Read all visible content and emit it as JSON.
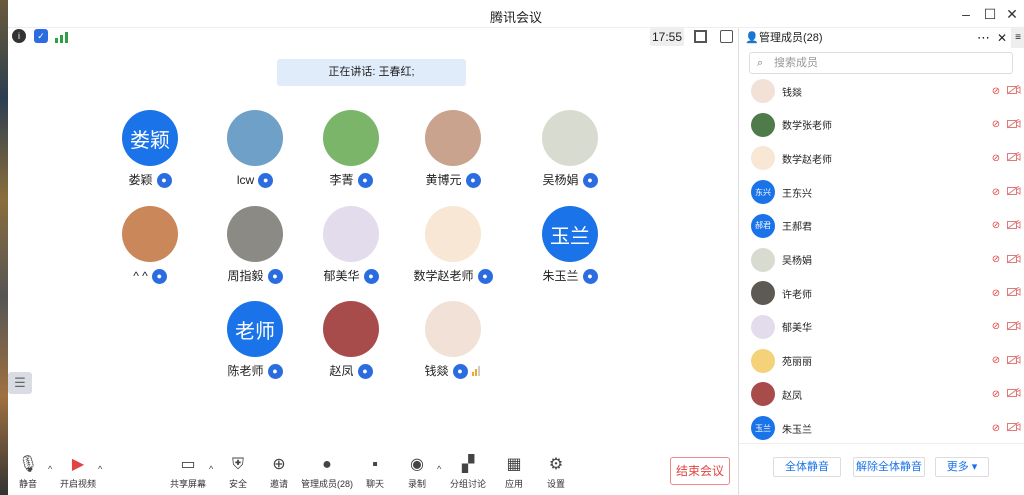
{
  "window": {
    "title": "腾讯会议"
  },
  "topbar": {
    "clock": "17:55"
  },
  "stage": {
    "speaking": "正在讲话: 王春红;",
    "participants": [
      {
        "name": "娄颖",
        "avatar_text": "娄颖",
        "kind": "blue"
      },
      {
        "name": "lcw",
        "avatar_text": "",
        "kind": "photo",
        "color": "#6fa0c8"
      },
      {
        "name": "李菁",
        "avatar_text": "",
        "kind": "photo",
        "color": "#7ab56a"
      },
      {
        "name": "黄博元",
        "avatar_text": "",
        "kind": "photo",
        "color": "#caa38f"
      },
      {
        "name": "吴杨娟",
        "avatar_text": "",
        "kind": "photo",
        "color": "#d8dcd0"
      },
      {
        "name": "^ ^",
        "avatar_text": "",
        "kind": "photo",
        "color": "#c9875a"
      },
      {
        "name": "周指毅",
        "avatar_text": "",
        "kind": "photo",
        "color": "#8c8a85"
      },
      {
        "name": "郁美华",
        "avatar_text": "",
        "kind": "photo",
        "color": "#e3dced"
      },
      {
        "name": "数学赵老师",
        "avatar_text": "",
        "kind": "photo",
        "color": "#f7e7d4"
      },
      {
        "name": "朱玉兰",
        "avatar_text": "玉兰",
        "kind": "blue"
      },
      {
        "name": "陈老师",
        "avatar_text": "老师",
        "kind": "blue"
      },
      {
        "name": "赵凤",
        "avatar_text": "",
        "kind": "photo",
        "color": "#a74b4b"
      },
      {
        "name": "钱燚",
        "avatar_text": "",
        "kind": "photo",
        "color": "#f2e1d6"
      }
    ]
  },
  "bottombar": {
    "mute": "静音",
    "video": "开启视频",
    "share": "共享屏幕",
    "security": "安全",
    "invite": "邀请",
    "members": "管理成员(28)",
    "chat": "聊天",
    "record": "录制",
    "breakout": "分组讨论",
    "apps": "应用",
    "settings": "设置",
    "end": "结束会议"
  },
  "sidebar": {
    "title": "管理成员(28)",
    "search_placeholder": "搜索成员",
    "members": [
      {
        "name": "钱燚",
        "avatar_text": "",
        "color": "#f2e1d6"
      },
      {
        "name": "数学张老师",
        "avatar_text": "",
        "color": "#4f7a4a"
      },
      {
        "name": "数学赵老师",
        "avatar_text": "",
        "color": "#f7e7d4"
      },
      {
        "name": "王东兴",
        "avatar_text": "东兴",
        "color": "#1a73e8"
      },
      {
        "name": "王郝君",
        "avatar_text": "郝君",
        "color": "#1a73e8"
      },
      {
        "name": "吴杨娟",
        "avatar_text": "",
        "color": "#d8dcd0"
      },
      {
        "name": "许老师",
        "avatar_text": "",
        "color": "#5c5a52"
      },
      {
        "name": "郁美华",
        "avatar_text": "",
        "color": "#e3dced"
      },
      {
        "name": "苑丽丽",
        "avatar_text": "",
        "color": "#f3d27a"
      },
      {
        "name": "赵凤",
        "avatar_text": "",
        "color": "#a74b4b"
      },
      {
        "name": "朱玉兰",
        "avatar_text": "玉兰",
        "color": "#1a73e8"
      }
    ],
    "mute_all": "全体静音",
    "unmute_all": "解除全体静音",
    "more": "更多"
  }
}
